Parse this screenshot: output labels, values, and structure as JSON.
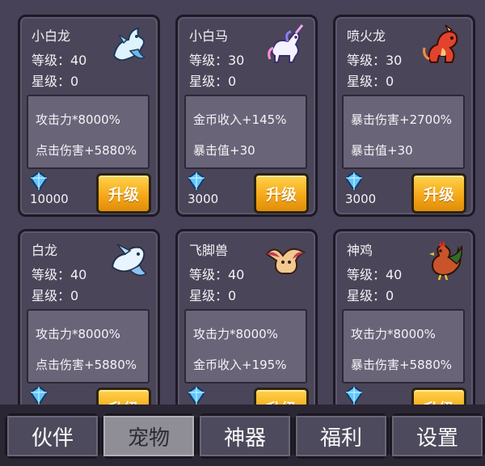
{
  "pets": [
    {
      "name": "小白龙",
      "level": "等级：40",
      "star": "星级：0",
      "attr1": "攻击力*8000%",
      "attr2": "点击伤害+5880%",
      "cost": "10000",
      "button": "升级",
      "icon": "white-dragon-icon"
    },
    {
      "name": "小白马",
      "level": "等级：30",
      "star": "星级：0",
      "attr1": "金币收入+145%",
      "attr2": "暴击值+30",
      "cost": "3000",
      "button": "升级",
      "icon": "unicorn-icon"
    },
    {
      "name": "喷火龙",
      "level": "等级：30",
      "star": "星级：0",
      "attr1": "暴击伤害+2700%",
      "attr2": "暴击值+30",
      "cost": "3000",
      "button": "升级",
      "icon": "fire-dragon-icon"
    },
    {
      "name": "白龙",
      "level": "等级：40",
      "star": "星级：0",
      "attr1": "攻击力*8000%",
      "attr2": "点击伤害+5880%",
      "cost": "",
      "button": "升级",
      "icon": "ice-dragon-icon"
    },
    {
      "name": "飞脚兽",
      "level": "等级：40",
      "star": "星级：0",
      "attr1": "攻击力*8000%",
      "attr2": "金币收入+195%",
      "cost": "",
      "button": "升级",
      "icon": "winged-beast-icon"
    },
    {
      "name": "神鸡",
      "level": "等级：40",
      "star": "星级：0",
      "attr1": "攻击力*8000%",
      "attr2": "暴击伤害+5880%",
      "cost": "",
      "button": "升级",
      "icon": "rooster-icon"
    }
  ],
  "tabs": [
    {
      "label": "伙伴",
      "active": false
    },
    {
      "label": "宠物",
      "active": true
    },
    {
      "label": "神器",
      "active": false
    },
    {
      "label": "福利",
      "active": false
    },
    {
      "label": "设置",
      "active": false
    }
  ],
  "colors": {
    "button": "#f4a516",
    "panel": "#6a6479",
    "card": "#4a4559",
    "gem": "#5fc6ff"
  }
}
